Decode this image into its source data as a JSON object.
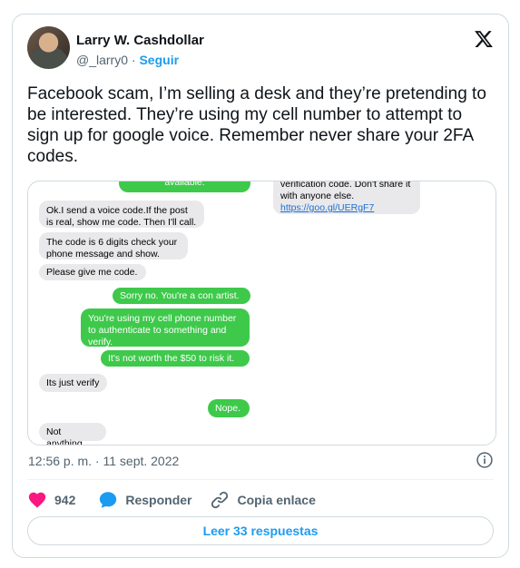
{
  "author": {
    "name": "Larry W. Cashdollar",
    "handle": "@_larry0",
    "separator": "·",
    "follow_label": "Seguir"
  },
  "tweet": {
    "text": "Facebook scam, I’m selling a desk and they’re pretending to be interested. They’re using my cell number to attempt to sign up for google voice. Remember never share your 2FA codes.",
    "timestamp": "12:56 p. m. · 11 sept. 2022"
  },
  "screenshot": {
    "right_top_prefix": "verification code. Don't share it with anyone else. ",
    "right_top_link": "https://goo.gl/UERgF7",
    "left_top_partial": "available.",
    "messages": [
      "Ok.I send a voice code.If the post is real, show me code. Then I'll call.",
      "The code is 6 digits check your phone message and show.",
      "Please give me code.",
      "Sorry no. You're a con artist.",
      "You're using my cell phone number to authenticate to something and verify.",
      "It's not worth the $50 to risk it.",
      "Its just verify",
      "Nope.",
      "Not anything"
    ]
  },
  "actions": {
    "likes": "942",
    "reply_label": "Responder",
    "copy_link_label": "Copia enlace",
    "read_replies_label": "Leer 33 respuestas"
  },
  "colors": {
    "accent": "#1d9bf0",
    "like": "#f91880",
    "reply_icon": "#1d9bf0",
    "bubble_out": "#3ec94b",
    "bubble_in": "#e9e9eb"
  }
}
